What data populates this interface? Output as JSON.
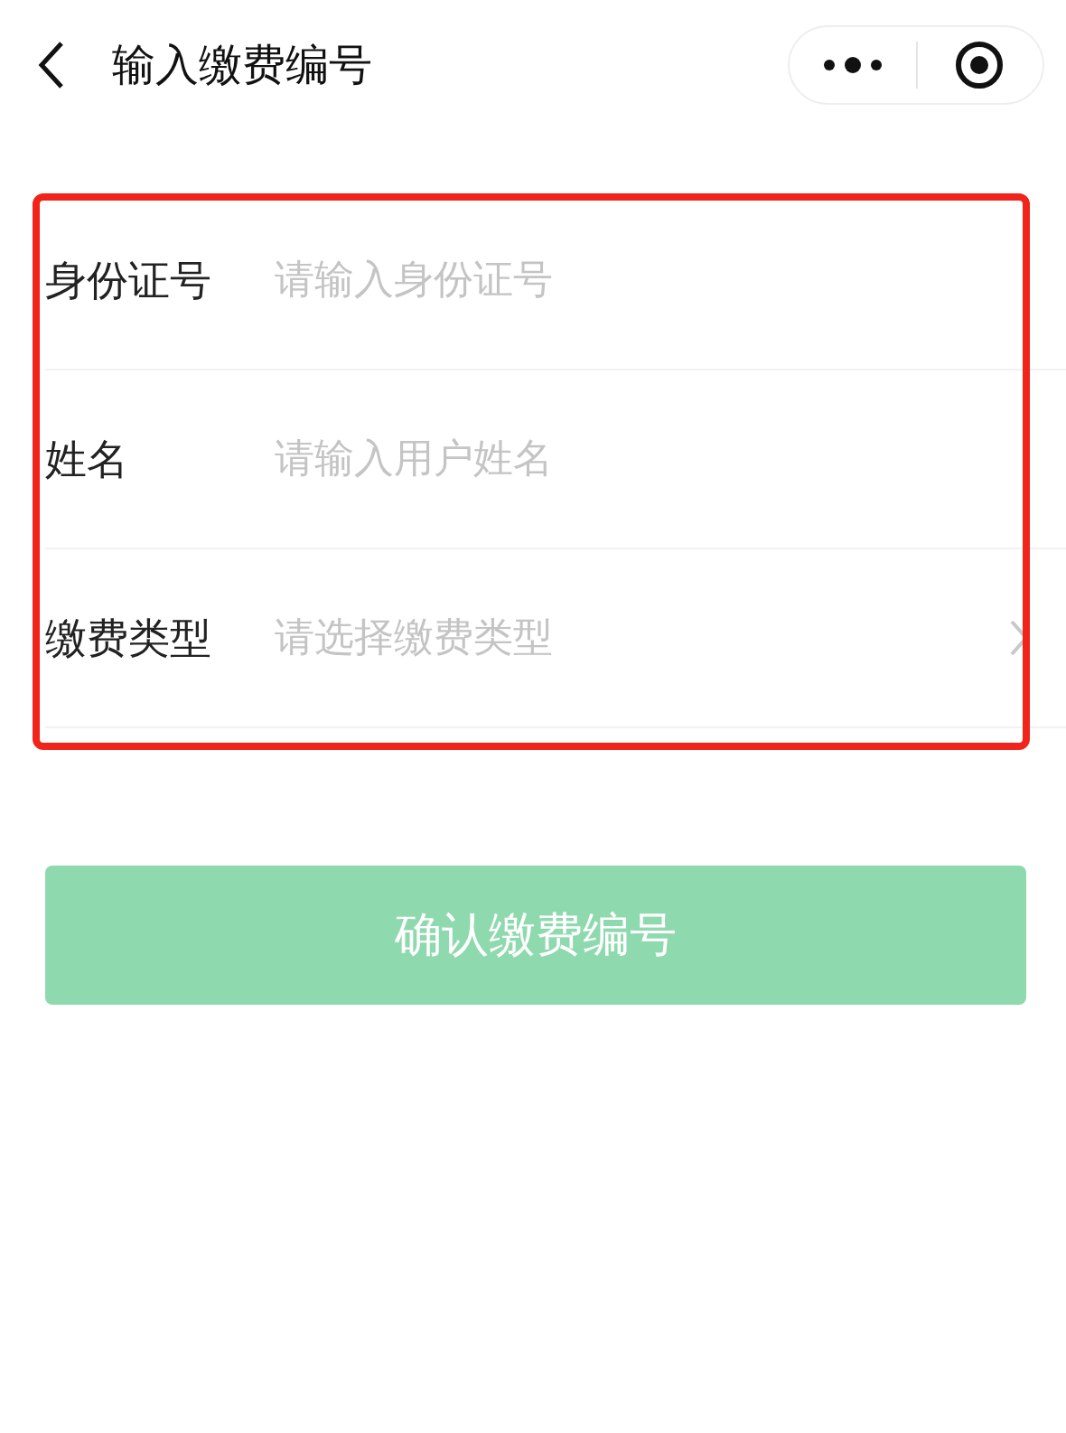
{
  "nav_bar": {
    "title": "输入缴费编号"
  },
  "form": {
    "fields": [
      {
        "label": "身份证号",
        "placeholder": "请输入身份证号",
        "kind": "input"
      },
      {
        "label": "姓名",
        "placeholder": "请输入用户姓名",
        "kind": "input"
      },
      {
        "label": "缴费类型",
        "placeholder": "请选择缴费类型",
        "kind": "select"
      }
    ]
  },
  "confirm_button": {
    "label": "确认缴费编号",
    "disabled": true
  }
}
